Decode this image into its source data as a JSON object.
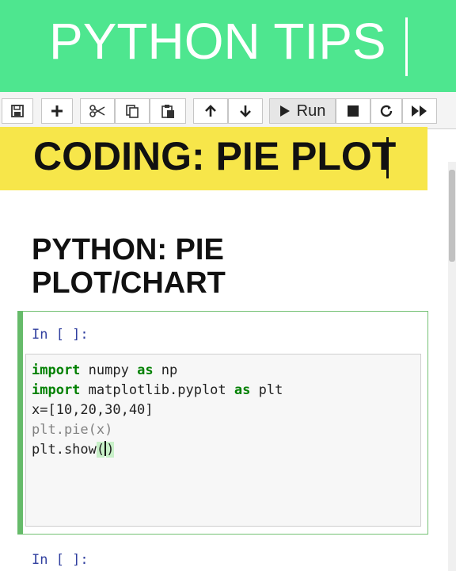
{
  "banner": {
    "title": "PYTHON TIPS"
  },
  "toolbar": {
    "buttons": [
      {
        "icon": "save-icon"
      },
      {
        "icon": "plus-icon"
      },
      {
        "icon": "cut-icon"
      },
      {
        "icon": "copy-icon"
      },
      {
        "icon": "paste-icon"
      },
      {
        "icon": "arrow-up-icon"
      },
      {
        "icon": "arrow-down-icon"
      },
      {
        "icon": "run-icon",
        "label": "Run"
      },
      {
        "icon": "stop-icon"
      },
      {
        "icon": "restart-icon"
      },
      {
        "icon": "fast-forward-icon"
      }
    ]
  },
  "overlay": {
    "title": "CODING: PIE PLOT"
  },
  "notebook": {
    "heading_line1": "PYTHON: PIE",
    "heading_line2": "PLOT/CHART",
    "cells": [
      {
        "prompt": "In [ ]:",
        "code": [
          {
            "kw": "import",
            "rest1": " numpy ",
            "kw2": "as",
            "rest2": " np"
          },
          {
            "kw": "import",
            "rest1": " matplotlib.pyplot ",
            "kw2": "as",
            "rest2": " plt"
          },
          {
            "text": "x=[10,20,30,40]"
          },
          {
            "text": "plt.pie(x)"
          },
          {
            "text": "plt.show"
          }
        ]
      },
      {
        "prompt": "In [ ]:"
      }
    ]
  },
  "colors": {
    "banner": "#4ee68f",
    "overlay": "#f7e64a",
    "cell_border": "#66bb6a",
    "keyword": "#008000"
  }
}
